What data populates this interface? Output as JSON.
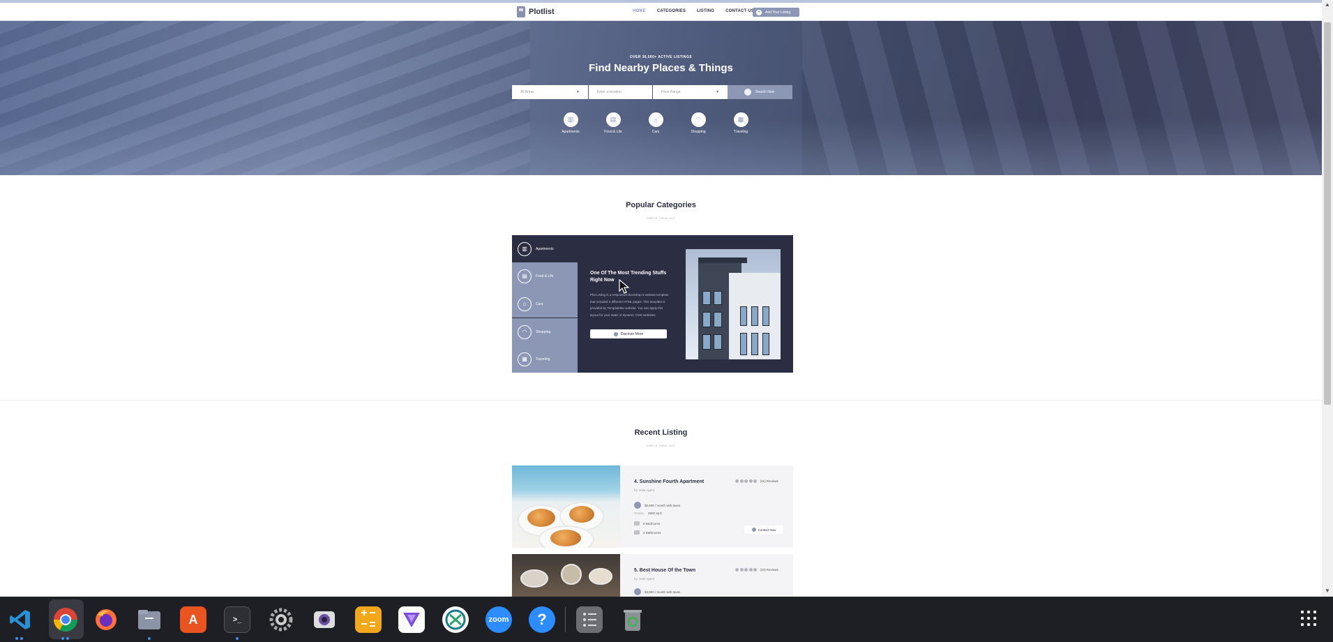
{
  "header": {
    "brand": "Plotlist",
    "nav": [
      "HOME",
      "CATEGORIES",
      "LISTING",
      "CONTACT US"
    ],
    "add_button": "Add Your Listing"
  },
  "hero": {
    "subtitle": "OVER 36,500+ ACTIVE LISTINGS",
    "title": "Find Nearby Places & Things",
    "search": {
      "area_value": "All Areas",
      "location_placeholder": "Enter a location",
      "price_value": "Price Range",
      "button": "Search Now"
    },
    "categories": [
      {
        "label": "Apartments",
        "icon": "building-icon"
      },
      {
        "label": "Food & Life",
        "icon": "food-icon"
      },
      {
        "label": "Cars",
        "icon": "car-icon"
      },
      {
        "label": "Shopping",
        "icon": "shopping-bag-icon"
      },
      {
        "label": "Traveling",
        "icon": "suitcase-icon"
      }
    ]
  },
  "popular": {
    "title": "Popular Categories",
    "subtitle": "CHECK THEM OUT",
    "tabs": [
      "Apartments",
      "Food & Life",
      "Cars",
      "Shopping",
      "Traveling"
    ],
    "heading": "One Of The Most Trending Stuffs Right Now",
    "body": "Plot Listing is a responsive Bootstrap 5 website template that included 4 different HTML pages. This template is provided by TemplateMo website. You can apply this layout for your static or dynamic CMS websites.",
    "button": "Discover More"
  },
  "recent": {
    "title": "Recent Listing",
    "subtitle": "CHECK THEM OUT",
    "listings": [
      {
        "title": "4. Sunshine Fourth Apartment",
        "by": "by: Sale Agent",
        "reviews": "(21) Reviews",
        "price": "$3,800 / month with taxes",
        "details_key": "Details:",
        "details": "3500 sq ft",
        "bedrooms": "6 Bedrooms",
        "bathrooms": "2 Bathrooms",
        "contact": "Contact Now"
      },
      {
        "title": "5. Best House Of the Town",
        "by": "by: Sale Agent",
        "reviews": "(32) Reviews",
        "price": "$3,800 / month with taxes"
      }
    ]
  },
  "taskbar": {
    "apps": [
      "vscode-icon",
      "chrome-icon",
      "firefox-icon",
      "files-icon",
      "app-store-icon",
      "terminal-icon",
      "settings-icon",
      "screenshot-icon",
      "calculator-icon",
      "vpn-icon",
      "remote-desktop-icon",
      "zoom-icon",
      "help-icon",
      "task-manager-icon",
      "trash-icon"
    ],
    "zoom_label": "zoom"
  },
  "colors": {
    "accent": "#8c97b5",
    "dark": "#2b2d42"
  }
}
